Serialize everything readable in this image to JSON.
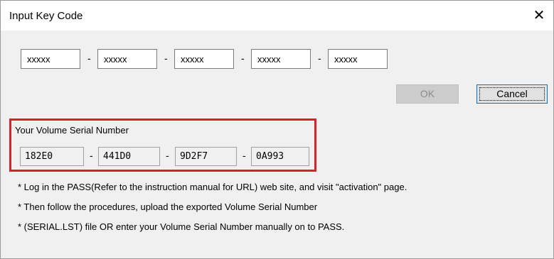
{
  "dialog": {
    "title": "Input Key Code",
    "close_glyph": "✕"
  },
  "key_fields": [
    {
      "value": "xxxxx"
    },
    {
      "value": "xxxxx"
    },
    {
      "value": "xxxxx"
    },
    {
      "value": "xxxxx"
    },
    {
      "value": "xxxxx"
    }
  ],
  "separator": "-",
  "buttons": {
    "ok_label": "OK",
    "ok_enabled": false,
    "cancel_label": "Cancel"
  },
  "serial": {
    "label": "Your Volume Serial Number",
    "parts": [
      "182E0",
      "441D0",
      "9D2F7",
      "0A993"
    ],
    "highlight_color": "#d0252f"
  },
  "notes": [
    "* Log in the PASS(Refer to the instruction manual for URL) web site, and visit \"activation\" page.",
    "* Then follow the procedures, upload the exported Volume Serial Number",
    "* (SERIAL.LST) file OR enter your Volume Serial Number manually on to PASS."
  ]
}
